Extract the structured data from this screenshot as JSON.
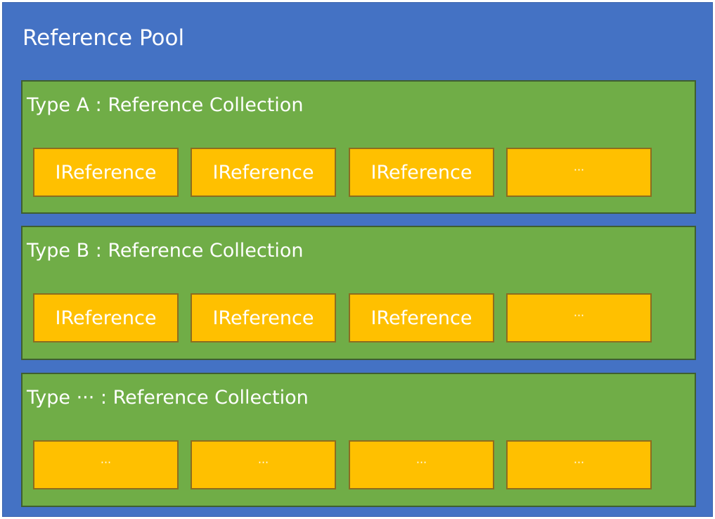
{
  "pool": {
    "title": "Reference Pool"
  },
  "collections": [
    {
      "title": "Type A : Reference Collection",
      "items": [
        "IReference",
        "IReference",
        "IReference",
        "···"
      ]
    },
    {
      "title": "Type B : Reference Collection",
      "items": [
        "IReference",
        "IReference",
        "IReference",
        "···"
      ]
    },
    {
      "title": "Type ··· : Reference Collection",
      "items": [
        "···",
        "···",
        "···",
        "···"
      ]
    }
  ],
  "colors": {
    "pool": "#4472c4",
    "collection": "#70ad47",
    "reference": "#ffc000",
    "text": "#ffffff"
  }
}
